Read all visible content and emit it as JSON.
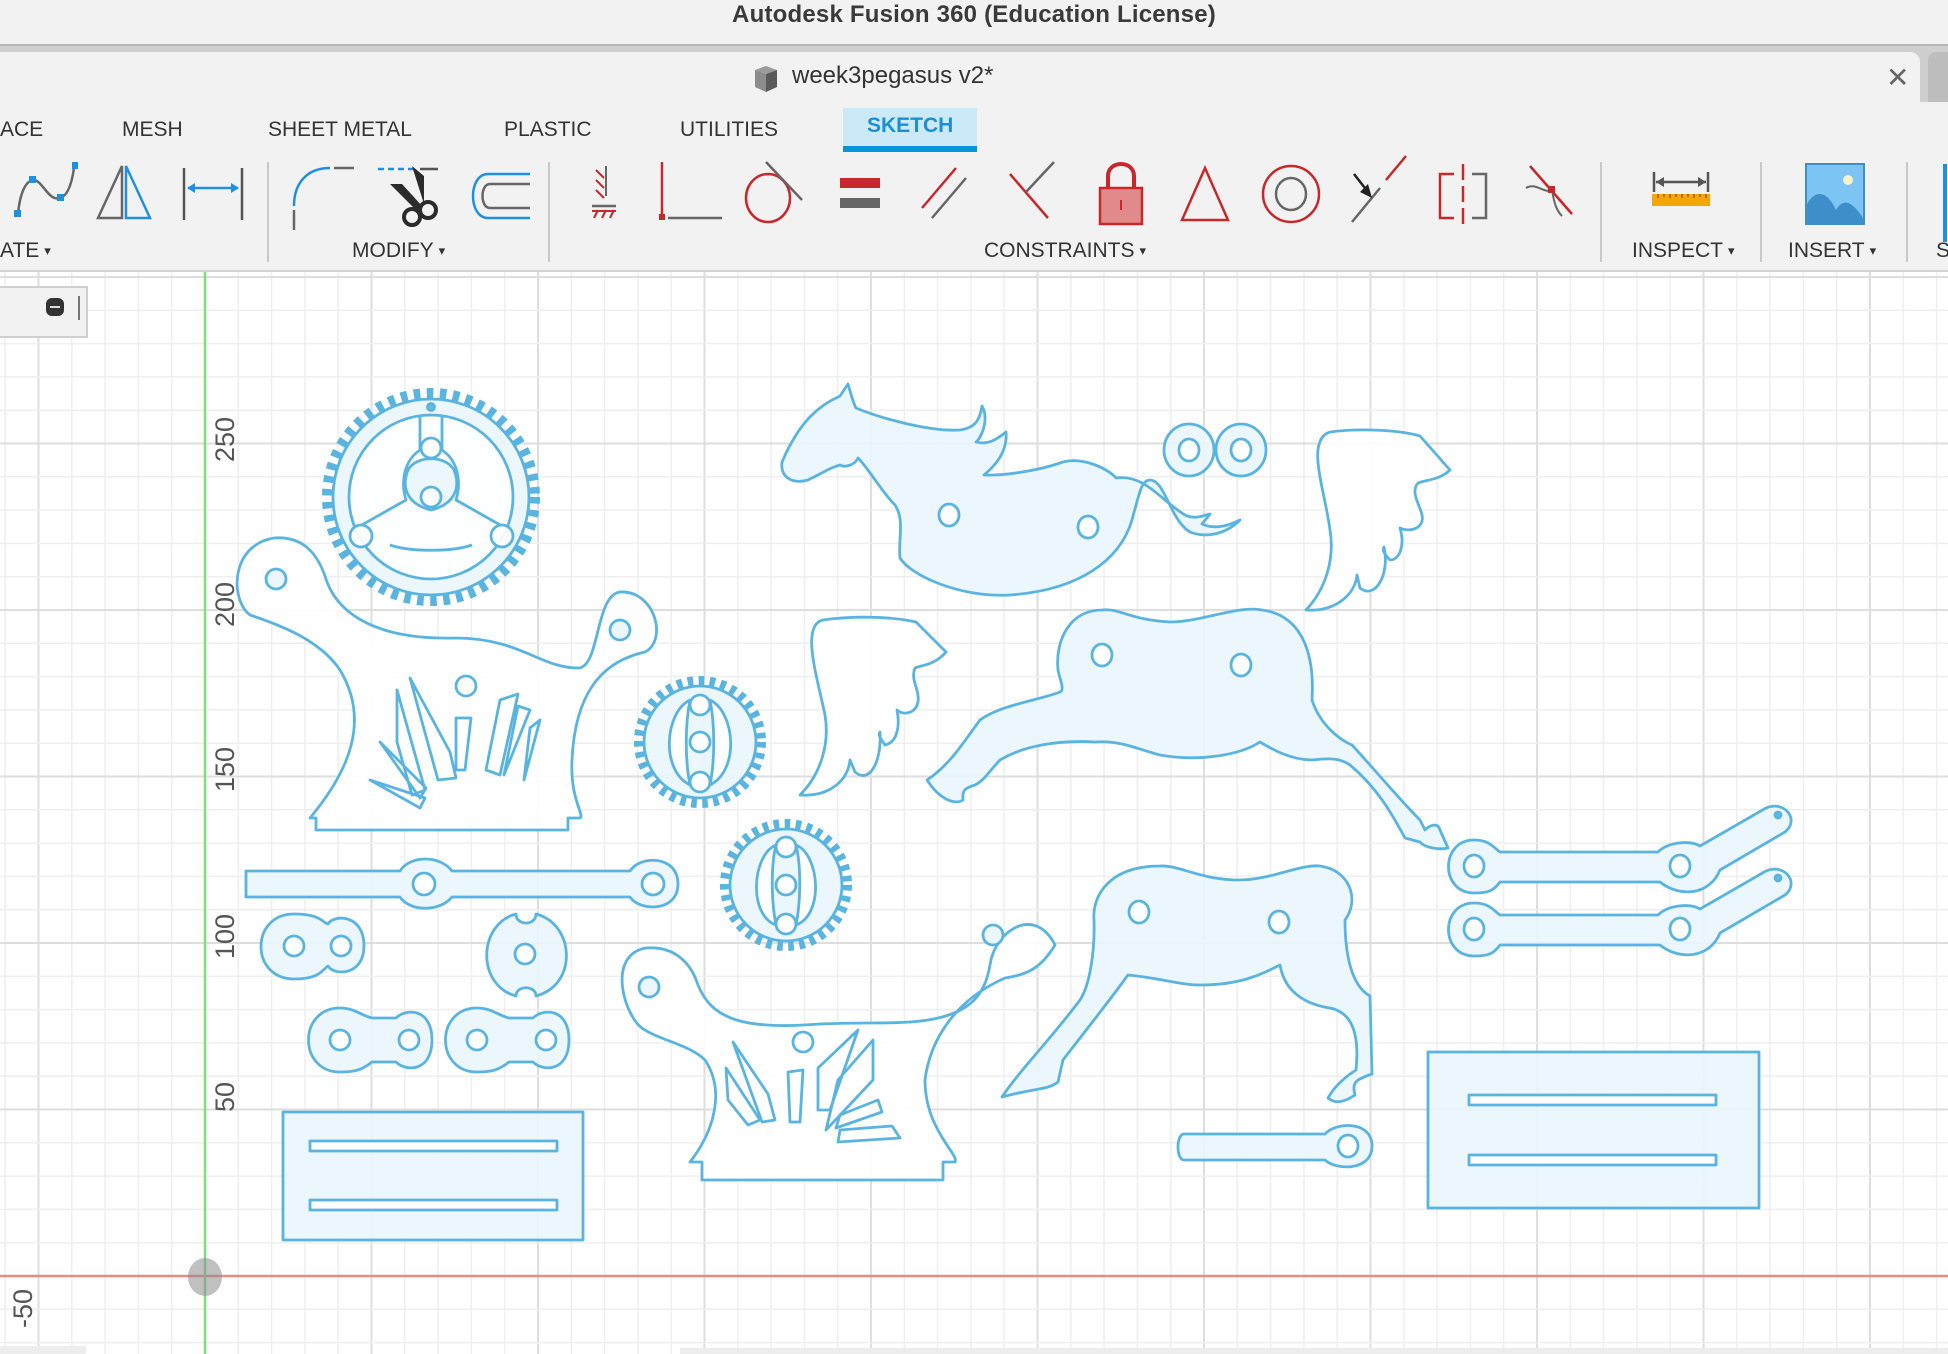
{
  "window": {
    "title": "Autodesk Fusion 360 (Education License)"
  },
  "document_tab": {
    "label": "week3pegasus v2*",
    "icon": "document-cube-icon",
    "close_icon": "close-icon"
  },
  "ribbon": {
    "tabs": [
      {
        "label": "ACE",
        "active": false
      },
      {
        "label": "MESH",
        "active": false
      },
      {
        "label": "SHEET METAL",
        "active": false
      },
      {
        "label": "PLASTIC",
        "active": false
      },
      {
        "label": "UTILITIES",
        "active": false
      },
      {
        "label": "SKETCH",
        "active": true
      }
    ],
    "groups": [
      {
        "label": "ATE",
        "tools": [
          "spline-icon",
          "mirror-icon",
          "sketch-dimension-icon"
        ]
      },
      {
        "label": "MODIFY",
        "tools": [
          "fillet-icon",
          "trim-icon",
          "offset-icon"
        ]
      },
      {
        "label": "CONSTRAINTS",
        "tools": [
          "horizontal-vertical-icon",
          "coincident-icon",
          "tangent-icon",
          "equal-icon",
          "parallel-icon",
          "perpendicular-icon",
          "fix-unfix-icon",
          "midpoint-icon",
          "concentric-icon",
          "collinear-icon",
          "symmetry-icon",
          "curvature-icon"
        ]
      },
      {
        "label": "INSPECT",
        "tools": [
          "measure-icon"
        ]
      },
      {
        "label": "INSERT",
        "tools": [
          "insert-image-icon"
        ]
      },
      {
        "label": "S",
        "tools": []
      }
    ],
    "dropdown_caret": "▾"
  },
  "canvas": {
    "axis_labels": [
      "250",
      "200",
      "150",
      "100",
      "50",
      "-50"
    ],
    "colors": {
      "sketch_line": "#5ab4e0",
      "profile_fill": "#eaf5fd",
      "x_axis": "#e8898b",
      "y_axis": "#7fdc7f",
      "grid_minor": "#efefef",
      "grid_major": "#dedede"
    },
    "sketch_parts": [
      "large-gear",
      "stand-left",
      "small-gear-upper",
      "small-gear-lower",
      "long-link-bar",
      "double-link-small",
      "round-cam",
      "double-link-a",
      "double-link-b",
      "base-plate-left",
      "horse-head-body",
      "washer-pair",
      "wing-right",
      "wing-left",
      "horse-body-mid",
      "stand-right",
      "horse-body-lower",
      "crank-link-upper",
      "crank-link-lower",
      "short-link",
      "base-plate-right"
    ]
  }
}
